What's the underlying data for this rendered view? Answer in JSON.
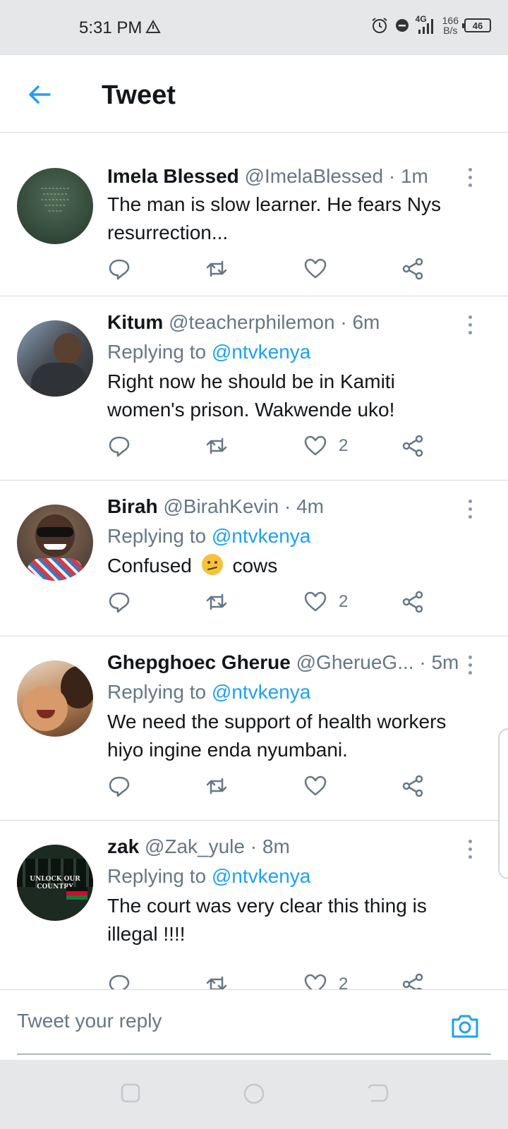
{
  "status_bar": {
    "time": "5:31 PM",
    "network": "4G",
    "speed_value": "166",
    "speed_unit": "B/s",
    "battery": "46"
  },
  "header": {
    "title": "Tweet"
  },
  "tweets": [
    {
      "name": "Imela Blessed",
      "handle": "@ImelaBlessed",
      "time": "1m",
      "reply_prefix": "",
      "reply_mention": "",
      "text_lines": [
        "The man is slow learner. He fears Nys",
        "resurrection..."
      ],
      "likes": "",
      "avatar_color": "#2f4a3a"
    },
    {
      "name": "Kitum",
      "handle": "@teacherphilemon",
      "time": "6m",
      "reply_prefix": "Replying to",
      "reply_mention": "@ntvkenya",
      "text_lines": [
        "Right now he should be in Kamiti",
        "women's prison. Wakwende uko!"
      ],
      "likes": "2",
      "avatar_color": "#3b4048"
    },
    {
      "name": "Birah",
      "handle": "@BirahKevin",
      "time": "4m",
      "reply_prefix": "Replying to",
      "reply_mention": "@ntvkenya",
      "text_before_emoji": "Confused",
      "text_after_emoji": "cows",
      "likes": "2",
      "avatar_color": "#6b5a4e"
    },
    {
      "name": "Ghepghoec Gherue",
      "handle": "@GherueG...",
      "time": "5m",
      "reply_prefix": "Replying to",
      "reply_mention": "@ntvkenya",
      "text_lines": [
        "We need the support of health workers",
        "hiyo ingine enda nyumbani."
      ],
      "likes": "",
      "avatar_color": "#b07a4c"
    },
    {
      "name": "zak",
      "handle": "@Zak_yule",
      "time": "8m",
      "reply_prefix": "Replying to",
      "reply_mention": "@ntvkenya",
      "text_lines": [
        "The court was very clear this thing is",
        "illegal !!!!"
      ],
      "likes": "2",
      "avatar_color": "#1c2a22",
      "avatar_text": [
        "UNLOCK OUR",
        "COUNTRY"
      ]
    }
  ],
  "reply_bar": {
    "placeholder": "Tweet your reply"
  },
  "colors": {
    "accent": "#1da1f2",
    "muted": "#657786"
  }
}
